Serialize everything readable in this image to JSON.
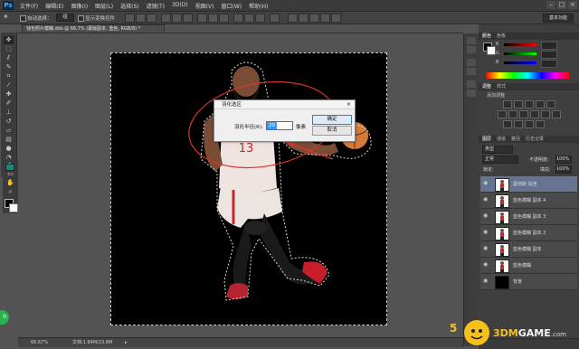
{
  "app": {
    "logo": "Ps"
  },
  "menu": [
    "文件(F)",
    "编辑(E)",
    "图像(I)",
    "图层(L)",
    "选择(S)",
    "滤镜(T)",
    "3D(D)",
    "视图(V)",
    "窗口(W)",
    "帮助(H)"
  ],
  "window_controls": [
    "–",
    "□",
    "×"
  ],
  "options": {
    "auto_select": "自动选择：",
    "auto_select_value": "组",
    "show_transform": "显示变换控件",
    "essentials": "基本功能"
  },
  "document": {
    "tab_label": "钱包照片模糊.dds @ 66.7% (蒙版副本, 蓝色, RGB/8) *"
  },
  "dialog": {
    "title": "羽化选区",
    "close": "×",
    "label": "羽化半径(R):",
    "value": "20",
    "unit": "像素",
    "ok": "确定",
    "cancel": "取消"
  },
  "status": {
    "zoom": "66.67%",
    "info": "文档:1.84M/23.8M"
  },
  "panels": {
    "color_tabs": [
      "颜色",
      "色板"
    ],
    "color_labels": [
      "R",
      "G",
      "B"
    ],
    "adjust_tabs": [
      "调整",
      "样式"
    ],
    "adjust_title": "添加调整",
    "layer_tabs": [
      "图层",
      "通道",
      "路径",
      "历史记录"
    ],
    "kind": "类型",
    "blend": "正常",
    "opacity_label": "不透明度:",
    "opacity": "100%",
    "lock_label": "锁定:",
    "fill_label": "填充:",
    "fill": "100%"
  },
  "layers": [
    {
      "name": "曼彻斯 站坐",
      "selected": true
    },
    {
      "name": "蓝色模糊 副本 4",
      "selected": false
    },
    {
      "name": "蓝色模糊 副本 3",
      "selected": false
    },
    {
      "name": "蓝色模糊 副本 2",
      "selected": false
    },
    {
      "name": "蓝色模糊 副本",
      "selected": false
    },
    {
      "name": "蓝色模糊",
      "selected": false
    },
    {
      "name": "背景",
      "selected": false,
      "black": true
    }
  ],
  "overlays": {
    "page_number": "5",
    "watermark_prefix": "3DM",
    "watermark_suffix": "GAME",
    "watermark_domain": ".com",
    "side_badge": "0"
  },
  "colors": {
    "accent_red": "#d9362f",
    "selected_layer": "#657591",
    "ps_blue": "#4fb1ff"
  }
}
